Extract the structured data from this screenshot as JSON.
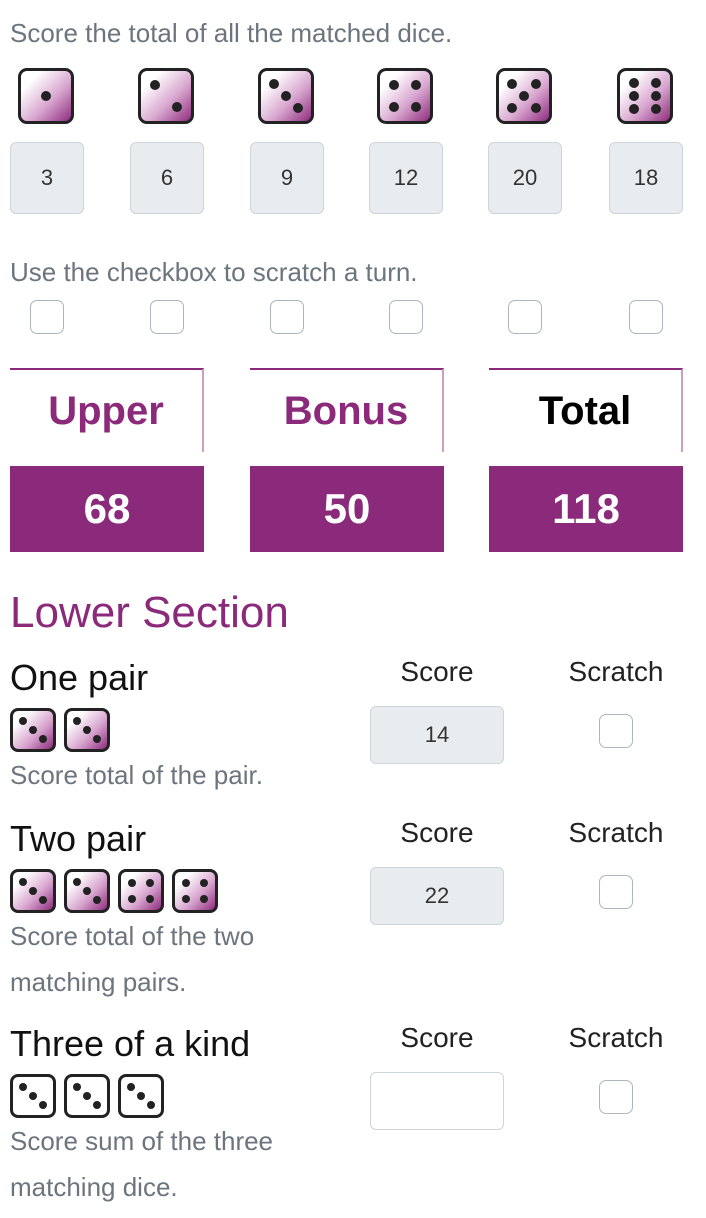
{
  "upper": {
    "instruction": "Score the total of all the matched dice.",
    "dice": [
      1,
      2,
      3,
      4,
      5,
      6
    ],
    "scores": [
      "3",
      "6",
      "9",
      "12",
      "20",
      "18"
    ],
    "scratch_instruction": "Use the checkbox to scratch a turn."
  },
  "totals": [
    {
      "label": "Upper",
      "value": "68"
    },
    {
      "label": "Bonus",
      "value": "50"
    },
    {
      "label": "Total",
      "value": "118"
    }
  ],
  "lower": {
    "title": "Lower Section",
    "score_label": "Score",
    "scratch_label": "Scratch",
    "rows": [
      {
        "name": "One pair",
        "dice": [
          3,
          3
        ],
        "desc": "Score total of the pair.",
        "score": "14",
        "dice_style": "filled"
      },
      {
        "name": "Two pair",
        "dice": [
          3,
          3,
          4,
          4
        ],
        "desc": "Score total of the two matching pairs.",
        "score": "22",
        "dice_style": "filled"
      },
      {
        "name": "Three of a kind",
        "dice": [
          3,
          3,
          3
        ],
        "desc": "Score sum of the three matching dice.",
        "score": "",
        "dice_style": "plain"
      }
    ]
  },
  "colors": {
    "accent": "#8b2a7b",
    "muted": "#6c757d",
    "field": "#e9ecef"
  }
}
